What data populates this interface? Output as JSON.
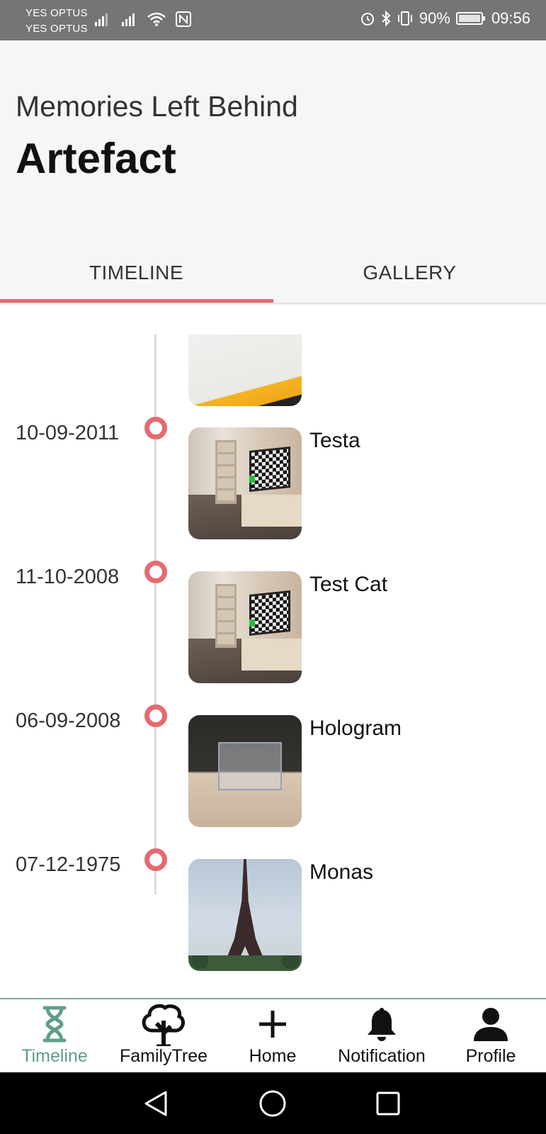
{
  "status_bar": {
    "carrier_1": "YES OPTUS",
    "carrier_2": "YES OPTUS",
    "battery": "90%",
    "time": "09:56",
    "icons": [
      "signal-icon",
      "signal-icon",
      "wifi-icon",
      "nfc-icon",
      "alarm-icon",
      "bluetooth-icon",
      "vibrate-icon",
      "battery-icon"
    ]
  },
  "header": {
    "subtitle": "Memories Left Behind",
    "title": "Artefact"
  },
  "tabs": [
    {
      "label": "TIMELINE",
      "active": true
    },
    {
      "label": "GALLERY",
      "active": false
    }
  ],
  "timeline": [
    {
      "date": "10-09-2011",
      "title": "Testa"
    },
    {
      "date": "11-10-2008",
      "title": "Test Cat"
    },
    {
      "date": "06-09-2008",
      "title": "Hologram"
    },
    {
      "date": "07-12-1975",
      "title": "Monas"
    }
  ],
  "bottom_nav": [
    {
      "label": "Timeline",
      "icon": "hourglass-icon",
      "active": true
    },
    {
      "label": "FamilyTree",
      "icon": "tree-icon",
      "active": false
    },
    {
      "label": "Home",
      "icon": "plus-icon",
      "active": false
    },
    {
      "label": "Notification",
      "icon": "bell-icon",
      "active": false
    },
    {
      "label": "Profile",
      "icon": "person-icon",
      "active": false
    }
  ],
  "colors": {
    "accent": "#e56a70",
    "nav_active": "#5e9e8c",
    "header_bg": "#f5f6f8",
    "status_bar_bg": "#757575"
  }
}
